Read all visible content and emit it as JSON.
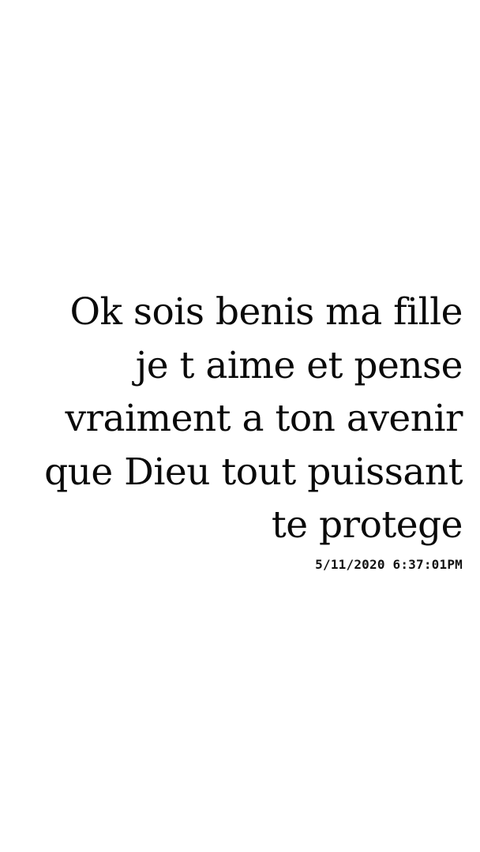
{
  "message": {
    "lines": [
      "Ok sois benis ma fille",
      "je t aime et pense",
      "vraiment a ton avenir",
      "que Dieu tout puissant",
      "te protege"
    ],
    "timestamp": "5/11/2020 6:37:01PM"
  }
}
